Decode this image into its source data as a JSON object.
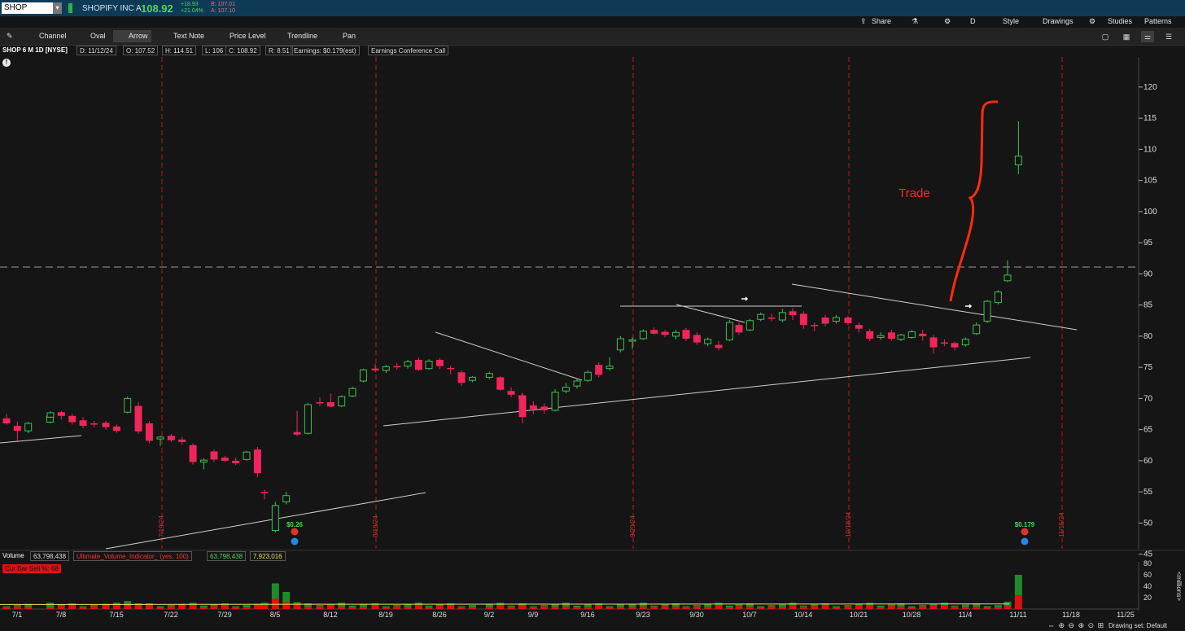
{
  "header": {
    "symbol": "SHOP",
    "company": "SHOPIFY INC A",
    "last_price": "108.92",
    "change": "+18.93",
    "change_pct": "+21.04%",
    "bid": "B: 107.01",
    "ask": "A: 107.10"
  },
  "top_right": {
    "share": "Share",
    "gear": "⚙",
    "period": "D",
    "style": "Style",
    "drawings": "Drawings",
    "gear2": "⚙",
    "studies": "Studies",
    "patterns": "Patterns"
  },
  "tools": {
    "pin": "✎",
    "channel": "Channel",
    "oval": "Oval",
    "arrow": "Arrow",
    "text_note": "Text Note",
    "price_level": "Price Level",
    "trendline": "Trendline",
    "pan": "Pan"
  },
  "info": {
    "title": "SHOP 6 M 1D [NYSE]",
    "date": "D: 11/12/24",
    "open": "O: 107.52",
    "high": "H: 114.51",
    "low": "L: 106",
    "close": "C: 108.92",
    "range": "R: 8.51",
    "earnings": "Earnings: $0.179(est)",
    "earnings_call": "Earnings Conference Call"
  },
  "volume_header": {
    "label": "Volume",
    "value": "63,798,438",
    "indicator": "Ultimate_Volume_Indicator_ (yes, 100)",
    "indicator_value": "63,798,438",
    "avg": "7,923,016",
    "sell_label": "Cur Bar Sell %: 68"
  },
  "footer": {
    "drawing_set": "Drawing set: Default"
  },
  "colors": {
    "up": "#3fbf4f",
    "down": "#f0265a",
    "bg": "#151515",
    "annotation": "#ff2b10"
  },
  "chart_data": {
    "type": "candlestick",
    "x_tick_labels": [
      "7/1",
      "7/8",
      "7/15",
      "7/22",
      "7/29",
      "8/5",
      "8/12",
      "8/19",
      "8/26",
      "9/2",
      "9/9",
      "9/16",
      "9/23",
      "9/30",
      "10/7",
      "10/14",
      "10/21",
      "10/28",
      "11/4",
      "11/11",
      "11/18",
      "11/25"
    ],
    "y_ticks": [
      45,
      50,
      55,
      60,
      65,
      70,
      75,
      80,
      85,
      90,
      95,
      100,
      105,
      110,
      115,
      120
    ],
    "ylim": [
      41.5,
      121
    ],
    "date_markers": [
      "7/19/24",
      "8/16/24",
      "9/20/24",
      "10/18/24",
      "11/15/24"
    ],
    "earnings_labels": [
      "$0.26",
      "$0.179"
    ],
    "annotation": "Trade",
    "price_level": 91.1,
    "candles": [
      {
        "d": "7/1",
        "o": 66.8,
        "h": 67.5,
        "l": 65.8,
        "c": 66.0
      },
      {
        "d": "7/2",
        "o": 65.6,
        "h": 66.3,
        "l": 63.2,
        "c": 64.8
      },
      {
        "d": "7/3",
        "o": 64.8,
        "h": 66.2,
        "l": 64.4,
        "c": 66.0
      },
      {
        "d": "7/5",
        "o": 66.2,
        "h": 67.4,
        "l": 66.0,
        "c": 67.2
      },
      {
        "d": "7/8",
        "o": 67.0,
        "h": 68.0,
        "l": 66.8,
        "c": 67.7
      },
      {
        "d": "7/9",
        "o": 67.8,
        "h": 68.0,
        "l": 66.6,
        "c": 67.2
      },
      {
        "d": "7/10",
        "o": 67.2,
        "h": 67.6,
        "l": 65.8,
        "c": 66.2
      },
      {
        "d": "7/11",
        "o": 66.5,
        "h": 67.0,
        "l": 65.2,
        "c": 65.6
      },
      {
        "d": "7/12",
        "o": 66.0,
        "h": 66.4,
        "l": 65.4,
        "c": 65.8
      },
      {
        "d": "7/15",
        "o": 66.1,
        "h": 66.4,
        "l": 65.0,
        "c": 65.4
      },
      {
        "d": "7/16",
        "o": 65.5,
        "h": 65.8,
        "l": 64.5,
        "c": 64.8
      },
      {
        "d": "7/17",
        "o": 67.8,
        "h": 70.3,
        "l": 67.6,
        "c": 70.0
      },
      {
        "d": "7/18",
        "o": 68.8,
        "h": 69.4,
        "l": 64.3,
        "c": 64.7
      },
      {
        "d": "7/19",
        "o": 66.0,
        "h": 66.4,
        "l": 62.8,
        "c": 63.2
      },
      {
        "d": "7/22",
        "o": 63.5,
        "h": 64.0,
        "l": 62.4,
        "c": 63.8
      },
      {
        "d": "7/23",
        "o": 64.0,
        "h": 64.3,
        "l": 63.0,
        "c": 63.3
      },
      {
        "d": "7/24",
        "o": 63.4,
        "h": 63.8,
        "l": 62.6,
        "c": 63.0
      },
      {
        "d": "7/25",
        "o": 62.5,
        "h": 62.8,
        "l": 59.4,
        "c": 59.8
      },
      {
        "d": "7/26",
        "o": 59.8,
        "h": 60.4,
        "l": 58.6,
        "c": 60.1
      },
      {
        "d": "7/29",
        "o": 61.5,
        "h": 61.8,
        "l": 59.8,
        "c": 60.2
      },
      {
        "d": "7/30",
        "o": 60.5,
        "h": 60.8,
        "l": 59.8,
        "c": 60.0
      },
      {
        "d": "7/31",
        "o": 60.0,
        "h": 60.5,
        "l": 59.3,
        "c": 59.6
      },
      {
        "d": "8/1",
        "o": 60.2,
        "h": 61.6,
        "l": 60.0,
        "c": 61.4
      },
      {
        "d": "8/2",
        "o": 61.8,
        "h": 62.2,
        "l": 57.3,
        "c": 58.0
      },
      {
        "d": "8/5",
        "o": 55.0,
        "h": 55.4,
        "l": 53.8,
        "c": 54.8
      },
      {
        "d": "8/6",
        "o": 48.8,
        "h": 53.4,
        "l": 48.5,
        "c": 52.8
      },
      {
        "d": "8/7",
        "o": 53.4,
        "h": 55.0,
        "l": 53.0,
        "c": 54.4
      },
      {
        "d": "8/8",
        "o": 64.6,
        "h": 68.0,
        "l": 64.0,
        "c": 64.2
      },
      {
        "d": "8/9",
        "o": 64.4,
        "h": 69.3,
        "l": 64.2,
        "c": 69.0
      },
      {
        "d": "8/12",
        "o": 69.4,
        "h": 70.2,
        "l": 68.8,
        "c": 69.2
      },
      {
        "d": "8/13",
        "o": 69.4,
        "h": 70.8,
        "l": 68.6,
        "c": 68.7
      },
      {
        "d": "8/14",
        "o": 68.8,
        "h": 70.5,
        "l": 68.6,
        "c": 70.3
      },
      {
        "d": "8/15",
        "o": 70.4,
        "h": 71.9,
        "l": 70.2,
        "c": 71.6
      },
      {
        "d": "8/16",
        "o": 72.8,
        "h": 74.8,
        "l": 72.6,
        "c": 74.6
      },
      {
        "d": "8/19",
        "o": 74.8,
        "h": 75.6,
        "l": 74.2,
        "c": 74.5
      },
      {
        "d": "8/20",
        "o": 74.5,
        "h": 75.4,
        "l": 74.1,
        "c": 75.1
      },
      {
        "d": "8/21",
        "o": 75.2,
        "h": 75.7,
        "l": 74.6,
        "c": 75.0
      },
      {
        "d": "8/22",
        "o": 75.2,
        "h": 76.2,
        "l": 74.8,
        "c": 75.9
      },
      {
        "d": "8/23",
        "o": 76.2,
        "h": 76.6,
        "l": 74.4,
        "c": 74.6
      },
      {
        "d": "8/26",
        "o": 74.8,
        "h": 76.3,
        "l": 74.6,
        "c": 76.0
      },
      {
        "d": "8/27",
        "o": 76.2,
        "h": 76.5,
        "l": 74.7,
        "c": 75.2
      },
      {
        "d": "8/28",
        "o": 74.9,
        "h": 75.3,
        "l": 73.9,
        "c": 74.7
      },
      {
        "d": "8/29",
        "o": 74.2,
        "h": 74.5,
        "l": 72.0,
        "c": 72.5
      },
      {
        "d": "8/30",
        "o": 72.9,
        "h": 73.6,
        "l": 72.6,
        "c": 73.4
      },
      {
        "d": "9/3",
        "o": 73.4,
        "h": 74.3,
        "l": 73.1,
        "c": 74.0
      },
      {
        "d": "9/4",
        "o": 73.4,
        "h": 73.6,
        "l": 71.2,
        "c": 71.4
      },
      {
        "d": "9/5",
        "o": 71.2,
        "h": 71.8,
        "l": 70.2,
        "c": 70.6
      },
      {
        "d": "9/6",
        "o": 70.5,
        "h": 70.9,
        "l": 69.6,
        "c": 69.9
      },
      {
        "d": "9/9",
        "o": 70.5,
        "h": 70.8,
        "l": 66.0,
        "c": 67.0
      },
      {
        "d": "9/10",
        "o": 68.9,
        "h": 69.6,
        "l": 67.5,
        "c": 68.3
      },
      {
        "d": "9/11",
        "o": 68.7,
        "h": 69.2,
        "l": 67.6,
        "c": 68.1
      },
      {
        "d": "9/12",
        "o": 68.1,
        "h": 71.5,
        "l": 67.9,
        "c": 71.0
      },
      {
        "d": "9/13",
        "o": 71.2,
        "h": 72.5,
        "l": 70.8,
        "c": 71.8
      },
      {
        "d": "9/16",
        "o": 72.0,
        "h": 73.1,
        "l": 71.6,
        "c": 72.8
      },
      {
        "d": "9/17",
        "o": 72.9,
        "h": 74.5,
        "l": 72.6,
        "c": 74.2
      },
      {
        "d": "9/18",
        "o": 75.4,
        "h": 75.8,
        "l": 73.4,
        "c": 73.8
      },
      {
        "d": "9/19",
        "o": 74.8,
        "h": 76.6,
        "l": 74.5,
        "c": 75.2
      },
      {
        "d": "9/20",
        "o": 77.8,
        "h": 80.0,
        "l": 77.4,
        "c": 79.6
      },
      {
        "d": "9/23",
        "o": 79.2,
        "h": 79.8,
        "l": 77.9,
        "c": 79.4
      },
      {
        "d": "9/24",
        "o": 79.6,
        "h": 81.1,
        "l": 79.4,
        "c": 80.8
      },
      {
        "d": "9/25",
        "o": 81.0,
        "h": 81.4,
        "l": 80.2,
        "c": 80.4
      },
      {
        "d": "9/26",
        "o": 80.7,
        "h": 81.0,
        "l": 79.8,
        "c": 80.2
      },
      {
        "d": "9/27",
        "o": 80.0,
        "h": 81.0,
        "l": 79.5,
        "c": 80.6
      },
      {
        "d": "9/30",
        "o": 81.0,
        "h": 81.3,
        "l": 79.2,
        "c": 79.6
      },
      {
        "d": "10/1",
        "o": 80.2,
        "h": 80.6,
        "l": 78.6,
        "c": 79.0
      },
      {
        "d": "10/2",
        "o": 78.8,
        "h": 79.8,
        "l": 78.4,
        "c": 79.5
      },
      {
        "d": "10/3",
        "o": 78.6,
        "h": 79.2,
        "l": 77.7,
        "c": 78.1
      },
      {
        "d": "10/4",
        "o": 79.4,
        "h": 82.6,
        "l": 79.2,
        "c": 82.2
      },
      {
        "d": "10/7",
        "o": 81.8,
        "h": 82.2,
        "l": 80.2,
        "c": 80.6
      },
      {
        "d": "10/8",
        "o": 81.0,
        "h": 82.8,
        "l": 80.8,
        "c": 82.5
      },
      {
        "d": "10/9",
        "o": 82.7,
        "h": 83.8,
        "l": 82.4,
        "c": 83.5
      },
      {
        "d": "10/10",
        "o": 83.0,
        "h": 83.6,
        "l": 82.4,
        "c": 82.8
      },
      {
        "d": "10/11",
        "o": 82.6,
        "h": 84.4,
        "l": 82.2,
        "c": 83.8
      },
      {
        "d": "10/14",
        "o": 84.0,
        "h": 84.5,
        "l": 82.6,
        "c": 83.4
      },
      {
        "d": "10/15",
        "o": 83.6,
        "h": 84.0,
        "l": 81.2,
        "c": 81.8
      },
      {
        "d": "10/16",
        "o": 81.8,
        "h": 82.2,
        "l": 80.8,
        "c": 81.6
      },
      {
        "d": "10/17",
        "o": 83.0,
        "h": 83.4,
        "l": 81.6,
        "c": 82.0
      },
      {
        "d": "10/18",
        "o": 82.4,
        "h": 83.4,
        "l": 82.0,
        "c": 83.0
      },
      {
        "d": "10/21",
        "o": 83.0,
        "h": 83.3,
        "l": 81.8,
        "c": 82.1
      },
      {
        "d": "10/22",
        "o": 81.8,
        "h": 82.2,
        "l": 80.6,
        "c": 81.2
      },
      {
        "d": "10/23",
        "o": 80.8,
        "h": 81.2,
        "l": 79.2,
        "c": 79.6
      },
      {
        "d": "10/24",
        "o": 79.8,
        "h": 80.6,
        "l": 79.4,
        "c": 80.1
      },
      {
        "d": "10/25",
        "o": 80.6,
        "h": 81.0,
        "l": 79.3,
        "c": 79.6
      },
      {
        "d": "10/28",
        "o": 79.5,
        "h": 80.4,
        "l": 79.2,
        "c": 80.2
      },
      {
        "d": "10/29",
        "o": 79.8,
        "h": 81.0,
        "l": 79.6,
        "c": 80.7
      },
      {
        "d": "10/30",
        "o": 80.4,
        "h": 81.0,
        "l": 79.3,
        "c": 80.0
      },
      {
        "d": "10/31",
        "o": 79.8,
        "h": 80.2,
        "l": 77.2,
        "c": 78.2
      },
      {
        "d": "11/1",
        "o": 79.0,
        "h": 79.5,
        "l": 78.4,
        "c": 78.8
      },
      {
        "d": "11/4",
        "o": 78.9,
        "h": 79.1,
        "l": 77.7,
        "c": 78.2
      },
      {
        "d": "11/5",
        "o": 78.6,
        "h": 79.8,
        "l": 78.3,
        "c": 79.5
      },
      {
        "d": "11/6",
        "o": 80.4,
        "h": 82.2,
        "l": 80.2,
        "c": 81.8
      },
      {
        "d": "11/7",
        "o": 82.4,
        "h": 85.8,
        "l": 82.1,
        "c": 85.6
      },
      {
        "d": "11/8",
        "o": 85.4,
        "h": 87.4,
        "l": 85.1,
        "c": 87.1
      },
      {
        "d": "11/11",
        "o": 88.9,
        "h": 92.2,
        "l": 88.7,
        "c": 89.8
      },
      {
        "d": "11/12",
        "o": 107.5,
        "h": 114.5,
        "l": 106.0,
        "c": 108.9
      }
    ],
    "volume_axis_label": "<millions>",
    "volume_ticks": [
      20,
      40,
      60,
      80
    ],
    "volume_ylim": [
      0,
      80
    ]
  }
}
